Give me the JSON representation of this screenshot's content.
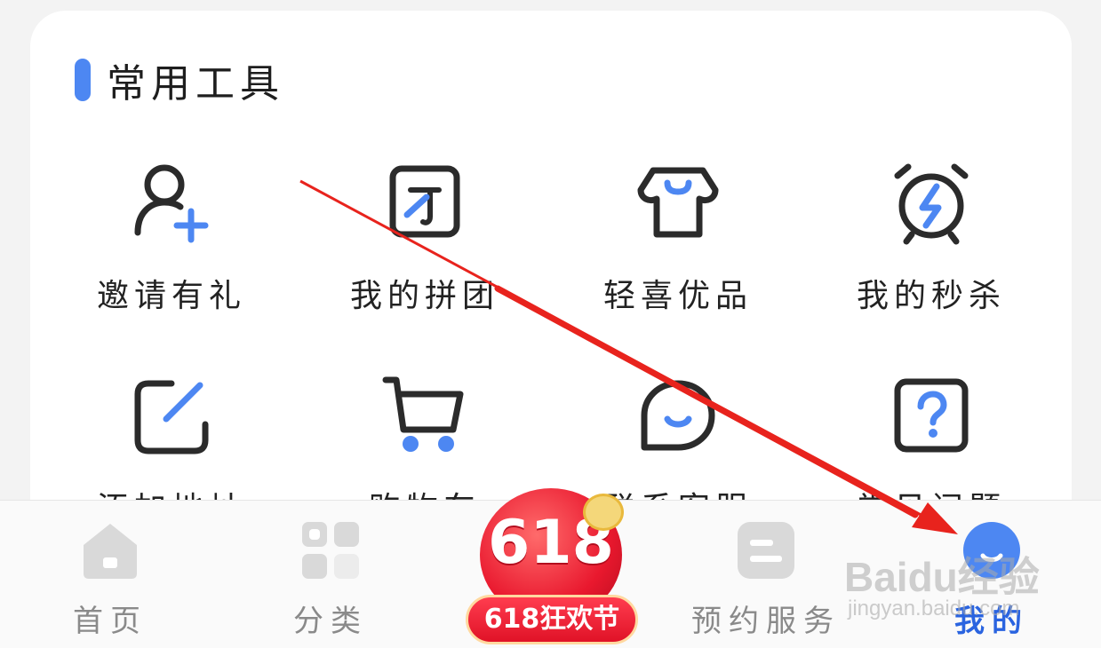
{
  "section": {
    "title": "常用工具"
  },
  "tools": [
    {
      "label": "邀请有礼",
      "icon": "add-user-icon"
    },
    {
      "label": "我的拼团",
      "icon": "group-buy-icon"
    },
    {
      "label": "轻喜优品",
      "icon": "shop-icon"
    },
    {
      "label": "我的秒杀",
      "icon": "alarm-flash-icon"
    },
    {
      "label": "添加地址",
      "icon": "edit-icon"
    },
    {
      "label": "购物车",
      "icon": "cart-icon"
    },
    {
      "label": "联系客服",
      "icon": "chat-icon"
    },
    {
      "label": "常见问题",
      "icon": "help-icon"
    }
  ],
  "nav": {
    "home": "首页",
    "category": "分类",
    "promo_number": "618",
    "promo_label": "618狂欢节",
    "booking": "预约服务",
    "mine": "我的"
  },
  "watermark": {
    "logo": "Baidu经验",
    "site": "jingyan.baidu.com"
  },
  "colors": {
    "accent": "#4d87f2",
    "active_nav": "#2a64e0",
    "promo_red": "#e9182e",
    "arrow": "#e8231d"
  }
}
